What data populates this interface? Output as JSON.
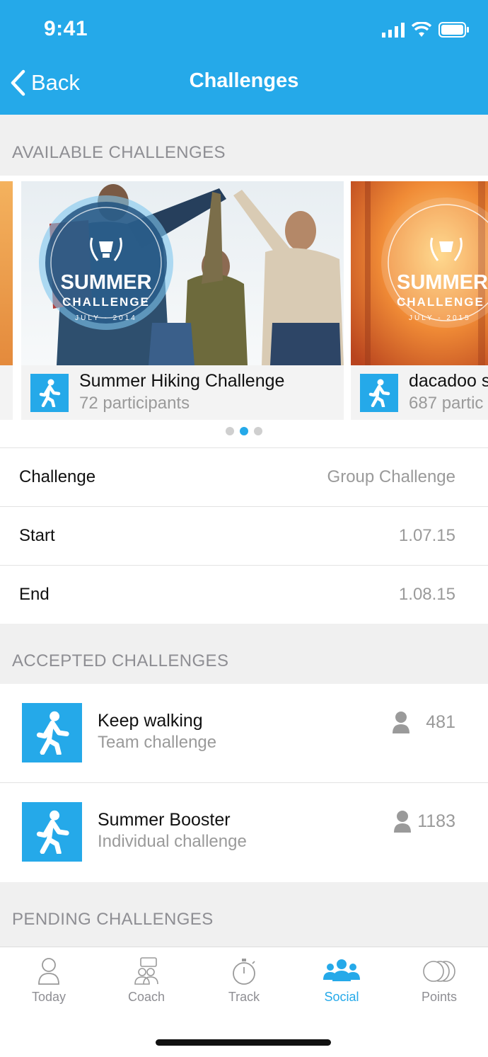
{
  "status": {
    "time": "9:41"
  },
  "nav": {
    "back_label": "Back",
    "title": "Challenges"
  },
  "sections": {
    "available": "AVAILABLE CHALLENGES",
    "accepted": "ACCEPTED CHALLENGES",
    "pending": "PENDING CHALLENGES"
  },
  "carousel": {
    "cards": [
      {
        "name": "Summer Hiking Challenge",
        "participants": "72 participants",
        "badge_title": "SUMMER",
        "badge_sub": "CHALLENGE",
        "badge_date": "JULY - 2014"
      },
      {
        "name": "dacadoo s",
        "participants": "687 partic",
        "badge_title": "SUMMER",
        "badge_sub": "CHALLENGE",
        "badge_date": "JULY - 2015"
      }
    ],
    "page_count": 3,
    "active_page": 2
  },
  "details": [
    {
      "label": "Challenge",
      "value": "Group Challenge"
    },
    {
      "label": "Start",
      "value": "1.07.15"
    },
    {
      "label": "End",
      "value": "1.08.15"
    }
  ],
  "accepted": [
    {
      "name": "Keep walking",
      "type": "Team challenge",
      "count": "481",
      "icon": "walking-person-icon"
    },
    {
      "name": "Summer Booster",
      "type": "Individual challenge",
      "count": "1183",
      "icon": "walking-person-icon"
    }
  ],
  "tabs": [
    {
      "label": "Today",
      "icon": "person-outline-icon"
    },
    {
      "label": "Coach",
      "icon": "coach-icon"
    },
    {
      "label": "Track",
      "icon": "stopwatch-icon"
    },
    {
      "label": "Social",
      "icon": "group-icon",
      "active": true
    },
    {
      "label": "Points",
      "icon": "coins-icon"
    }
  ],
  "colors": {
    "accent": "#25a9e9",
    "muted_text": "#9a9a9a",
    "section_bg": "#f0f0f0"
  }
}
